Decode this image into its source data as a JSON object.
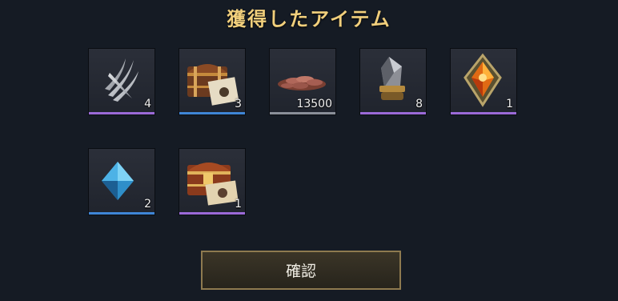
{
  "dialog": {
    "title": "獲得したアイテム",
    "confirm_label": "確認"
  },
  "items": [
    {
      "icon": "silver-claw-icon",
      "qty": "4",
      "rarity": "purple"
    },
    {
      "icon": "treasure-chest-with-map-icon",
      "qty": "3",
      "rarity": "blue"
    },
    {
      "icon": "copper-coins-pile-icon",
      "qty": "13500",
      "rarity": "gray"
    },
    {
      "icon": "black-stone-crystal-icon",
      "qty": "8",
      "rarity": "purple"
    },
    {
      "icon": "fire-crystal-icon",
      "qty": "1",
      "rarity": "purple"
    },
    {
      "icon": "blue-crystal-icon",
      "qty": "2",
      "rarity": "blue"
    },
    {
      "icon": "ornate-chest-with-scroll-icon",
      "qty": "1",
      "rarity": "purple"
    }
  ],
  "colors": {
    "background": "#151b24",
    "title": "#f1cf7c",
    "rarity_purple": "#9b6ad8",
    "rarity_blue": "#3f86d6",
    "rarity_gray": "#8a8f99",
    "button_border": "#8e7a4f"
  }
}
